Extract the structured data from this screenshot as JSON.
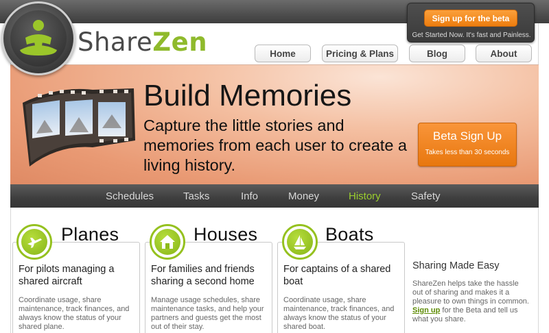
{
  "brand": {
    "name_part1": "Share",
    "name_part2": "Zen"
  },
  "nav": {
    "home": "Home",
    "pricing": "Pricing & Plans",
    "blog": "Blog",
    "about": "About"
  },
  "beta_box": {
    "button": "Sign up for the beta",
    "subtext": "Get Started Now. It's fast and Painless."
  },
  "hero": {
    "title": "Build Memories",
    "text": "Capture the little stories and memories from each user to create a living history.",
    "cta_label": "Beta Sign Up",
    "cta_sub": "Takes less than 30 seconds"
  },
  "menu": {
    "items": [
      "Schedules",
      "Tasks",
      "Info",
      "Money",
      "History",
      "Safety"
    ],
    "active": "History"
  },
  "cards": [
    {
      "title": "Planes",
      "icon": "plane-icon",
      "heading": "For pilots managing a shared aircraft",
      "body": "Coordinate usage, share maintenance, track finances, and always know the status of your shared plane."
    },
    {
      "title": "Houses",
      "icon": "house-icon",
      "heading": "For families and friends sharing a second home",
      "body": "Manage usage schedules, share maintenance tasks, and help your partners and guests get the most out of their stay."
    },
    {
      "title": "Boats",
      "icon": "sailboat-icon",
      "heading": "For captains of a shared boat",
      "body": "Coordinate usage, share maintenance, track finances, and always know the status of your shared boat."
    }
  ],
  "sidebar": {
    "title": "Sharing Made Easy",
    "text_before": "ShareZen helps take the hassle out of sharing and makes it a pleasure to own things in common.",
    "link": "Sign up",
    "text_after": "for the Beta and tell us what you share."
  },
  "colors": {
    "accent_green": "#95c11f",
    "cta_orange": "#f08418"
  }
}
